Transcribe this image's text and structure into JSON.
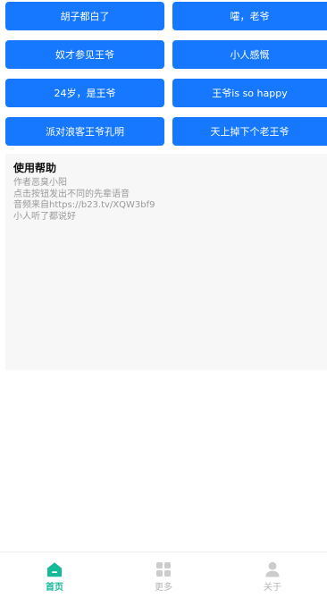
{
  "buttons": [
    {
      "left": "胡子都白了",
      "right": "嚯，老爷"
    },
    {
      "left": "奴才参见王爷",
      "right": "小人感慨"
    },
    {
      "left": "24岁，是王爷",
      "right": "王爷is so happy"
    },
    {
      "left": "派对浪客王爷孔明",
      "right": "天上掉下个老王爷"
    }
  ],
  "help": {
    "title": "使用帮助",
    "lines": [
      "作者恶臭小阳",
      "点击按钮发出不同的先辈语音",
      "音频来自https://b23.tv/XQW3bf9",
      "小人听了都说好"
    ]
  },
  "tabbar": {
    "tabs": [
      {
        "label": "首页",
        "icon": "home-icon",
        "active": true
      },
      {
        "label": "更多",
        "icon": "grid-icon",
        "active": false
      },
      {
        "label": "关于",
        "icon": "user-icon",
        "active": false
      }
    ]
  },
  "colors": {
    "button_bg": "#1677ff",
    "active_tab": "#16b998",
    "inactive_tab": "#cccccc"
  }
}
